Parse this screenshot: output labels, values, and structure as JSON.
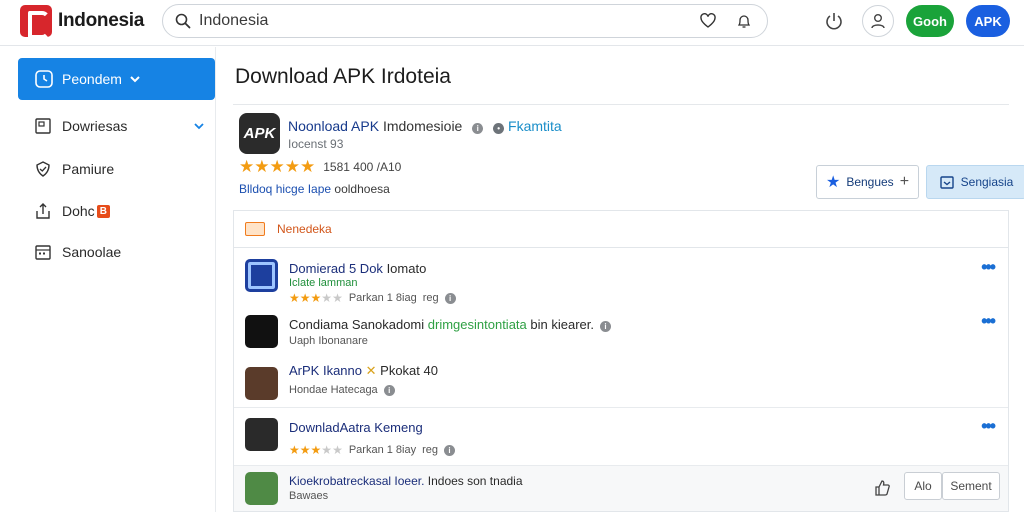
{
  "brand": {
    "name": "Indonesia",
    "color": "#d7262c"
  },
  "search": {
    "value": "Indonesia",
    "placeholder": "Indonesia"
  },
  "top_right": {
    "green_button": "Gooh",
    "blue_button": "APK"
  },
  "sidebar": {
    "primary": {
      "label": "Peondem",
      "icon": "clock-icon"
    },
    "items": [
      {
        "label": "Dowriesas",
        "icon": "window-icon"
      },
      {
        "label": "Pamiure",
        "icon": "shield-icon"
      },
      {
        "label": "Dohc",
        "badge": "B",
        "icon": "upload-icon"
      },
      {
        "label": "Sanoolae",
        "icon": "calendar-icon"
      }
    ]
  },
  "main": {
    "title": "Download APK Irdoteia",
    "app": {
      "icon_text": "APK",
      "name": "Noonload APK",
      "name_rest": "Imdomesioie",
      "developer": "Fkamtita",
      "subtitle": "Iocenst 93",
      "rating_text": "1581  400 /A10",
      "tags": "Blldoq hicge Iape",
      "tags_rest": "ooldhoesa",
      "btn_outline": "Bengues",
      "btn_fill": "Sengiasia"
    },
    "list": {
      "header": "Nenedeka",
      "rows": [
        {
          "title": "Domierad 5 Dok",
          "title_rest": "Iomato",
          "sub": "Iclate lamman",
          "meta": "Parkan 1 8iag",
          "meta2": "reg"
        },
        {
          "title": "Condiama Sanokadomi",
          "title_hl": "drimgesintontiata",
          "title_rest": "bin kiearer.",
          "sub": "Uaph Ibonanare"
        },
        {
          "title": "ArPK Ikanno",
          "title_rest": "Pkokat 40",
          "sub": "Hondae Hatecaga"
        },
        {
          "title": "DownladAatra",
          "title_rest": "Kemeng",
          "meta": "Parkan 1 8iay",
          "meta2": "reg"
        },
        {
          "title": "Kioekrobatreckasal Ioeer.",
          "title_rest": "Indoes son tnadia",
          "sub": "Bawaes",
          "act1": "Alo",
          "act2": "Sement"
        }
      ]
    }
  },
  "colors": {
    "accent": "#1683e4",
    "star": "#f39c12",
    "green": "#1aa33a",
    "blue": "#1a5fe0"
  }
}
